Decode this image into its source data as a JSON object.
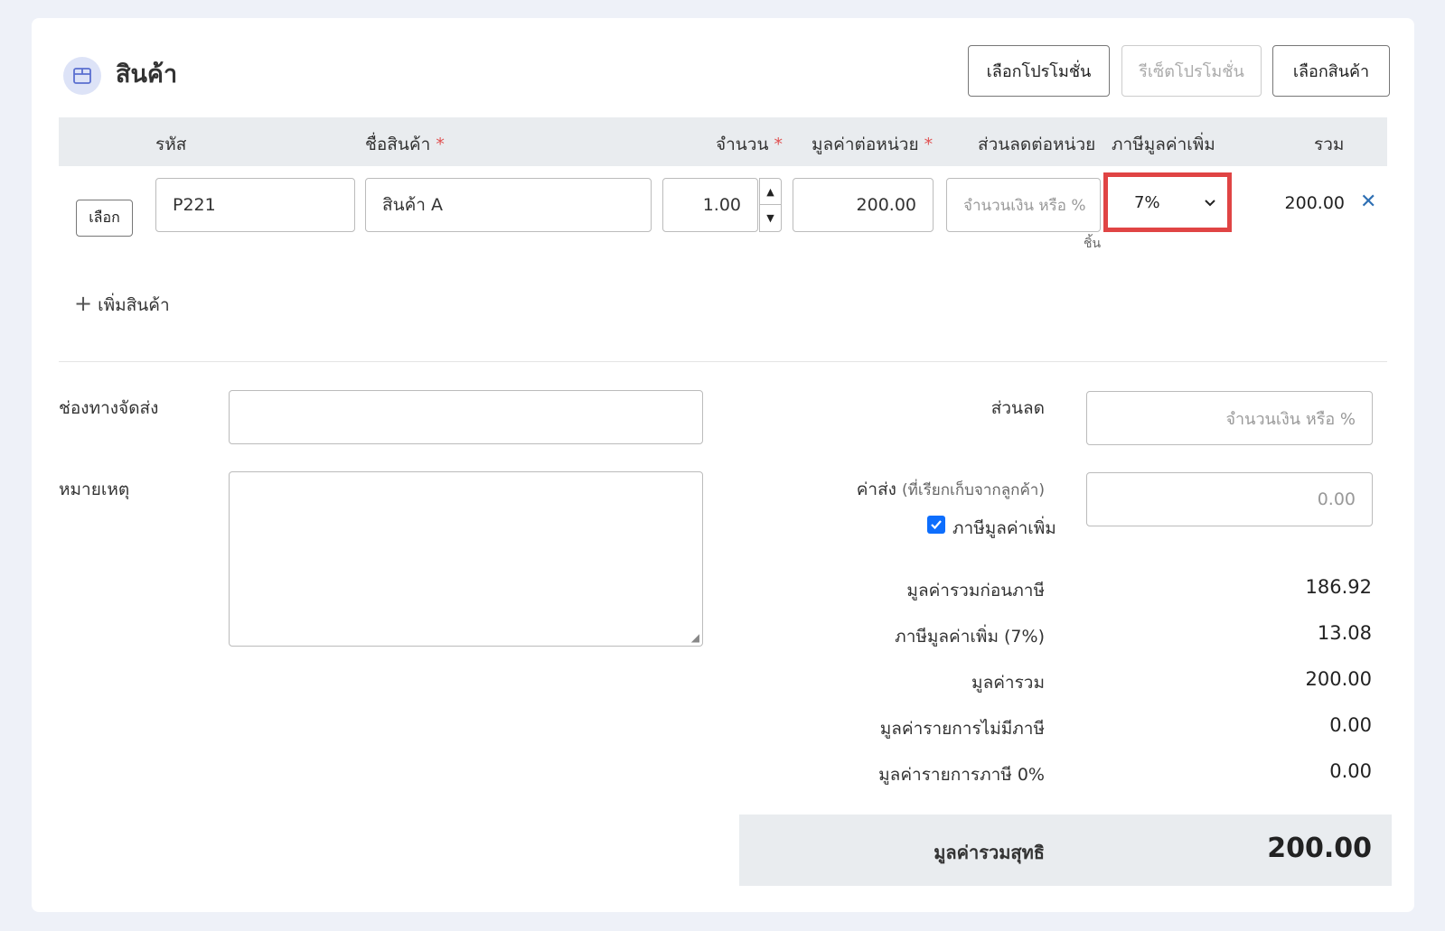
{
  "section": {
    "title": "สินค้า",
    "icon": "box-icon"
  },
  "toolbar": {
    "choose_promotion": "เลือกโปรโมชั่น",
    "reset_promotion": "รีเซ็ตโปรโมชั่น",
    "choose_product": "เลือกสินค้า"
  },
  "table": {
    "headers": {
      "code": "รหัส",
      "name": "ชื่อสินค้า",
      "qty": "จำนวน",
      "unit_price": "มูลค่าต่อหน่วย",
      "discount": "ส่วนลดต่อหน่วย",
      "vat": "ภาษีมูลค่าเพิ่ม",
      "total": "รวม"
    },
    "required_mark": "*",
    "rows": [
      {
        "select_label": "เลือก",
        "code": "P221",
        "name": "สินค้า A",
        "qty": "1.00",
        "unit_price": "200.00",
        "discount_placeholder": "จำนวนเงิน หรือ %",
        "unit": "ชิ้น",
        "vat": "7%",
        "total": "200.00"
      }
    ]
  },
  "add_product": "เพิ่มสินค้า",
  "form": {
    "shipping_channel_label": "ช่องทางจัดส่ง",
    "shipping_channel_value": "",
    "note_label": "หมายเหตุ",
    "note_value": "",
    "discount_label": "ส่วนลด",
    "discount_placeholder": "จำนวนเงิน หรือ %",
    "shipping_fee_label": "ค่าส่ง",
    "shipping_fee_sub": "(ที่เรียกเก็บจากลูกค้า)",
    "shipping_fee_placeholder": "0.00",
    "vat_checkbox_label": "ภาษีมูลค่าเพิ่ม",
    "vat_checked": true
  },
  "summary": {
    "pre_tax_label": "มูลค่ารวมก่อนภาษี",
    "pre_tax_value": "186.92",
    "vat_label": "ภาษีมูลค่าเพิ่ม (7%)",
    "vat_value": "13.08",
    "total_label": "มูลค่ารวม",
    "total_value": "200.00",
    "non_tax_label": "มูลค่ารายการไม่มีภาษี",
    "non_tax_value": "0.00",
    "zero_tax_label": "มูลค่ารายการภาษี 0%",
    "zero_tax_value": "0.00",
    "net_label": "มูลค่ารวมสุทธิ",
    "net_value": "200.00"
  },
  "colors": {
    "accent": "#2e6fb3",
    "highlight": "#e04444",
    "required": "#e05252",
    "header_bg": "#e9ecef"
  }
}
